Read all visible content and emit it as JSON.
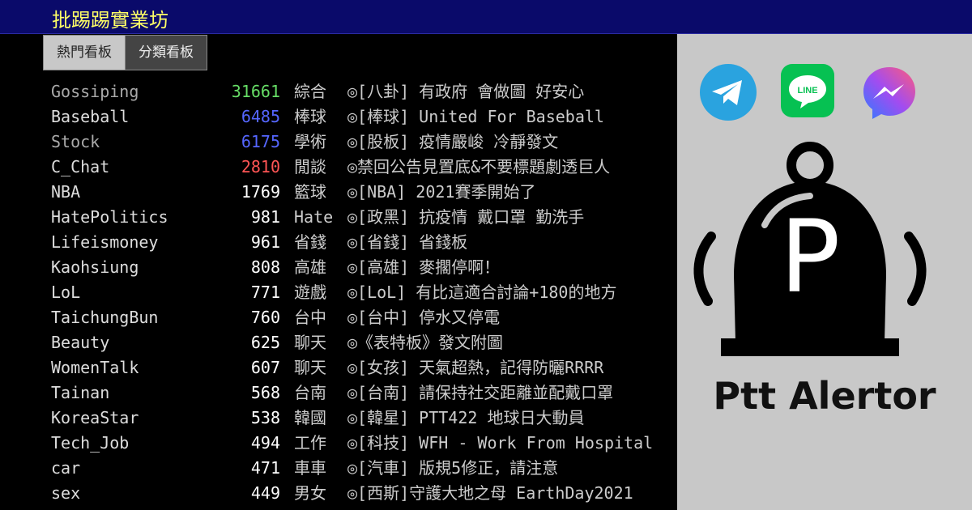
{
  "header": {
    "site_title": "批踢踢實業坊"
  },
  "tabs": [
    {
      "label": "熱門看板",
      "active": true
    },
    {
      "label": "分類看板",
      "active": false
    }
  ],
  "boards": [
    {
      "name": "Gossiping",
      "count": "31661",
      "count_color": "#66dd66",
      "category": "綜合",
      "title": "◎[八卦] 有政府 會做圖 好安心",
      "name_color": "#aaaaaa"
    },
    {
      "name": "Baseball",
      "count": "6485",
      "count_color": "#5566ff",
      "category": "棒球",
      "title": "◎[棒球] United For Baseball",
      "name_color": "#dddddd"
    },
    {
      "name": "Stock",
      "count": "6175",
      "count_color": "#5566ff",
      "category": "學術",
      "title": "◎[股板] 疫情嚴峻 冷靜發文",
      "name_color": "#aaaaaa"
    },
    {
      "name": "C_Chat",
      "count": "2810",
      "count_color": "#ff5555",
      "category": "閒談",
      "title": "◎禁回公告見置底&不要標題劇透巨人",
      "name_color": "#dddddd"
    },
    {
      "name": "NBA",
      "count": "1769",
      "count_color": "#ffffff",
      "category": "籃球",
      "title": "◎[NBA] 2021賽季開始了",
      "name_color": "#dddddd"
    },
    {
      "name": "HatePolitics",
      "count": "981",
      "count_color": "#ffffff",
      "category": "Hate",
      "title": "◎[政黑] 抗疫情 戴口罩 勤洗手",
      "name_color": "#dddddd"
    },
    {
      "name": "Lifeismoney",
      "count": "961",
      "count_color": "#ffffff",
      "category": "省錢",
      "title": "◎[省錢] 省錢板",
      "name_color": "#dddddd"
    },
    {
      "name": "Kaohsiung",
      "count": "808",
      "count_color": "#ffffff",
      "category": "高雄",
      "title": "◎[高雄] 麥擱停啊！",
      "name_color": "#dddddd"
    },
    {
      "name": "LoL",
      "count": "771",
      "count_color": "#ffffff",
      "category": "遊戲",
      "title": "◎[LoL] 有比這適合討論+180的地方",
      "name_color": "#dddddd"
    },
    {
      "name": "TaichungBun",
      "count": "760",
      "count_color": "#ffffff",
      "category": "台中",
      "title": "◎[台中] 停水又停電",
      "name_color": "#dddddd"
    },
    {
      "name": "Beauty",
      "count": "625",
      "count_color": "#ffffff",
      "category": "聊天",
      "title": "◎《表特板》發文附圖",
      "name_color": "#dddddd"
    },
    {
      "name": "WomenTalk",
      "count": "607",
      "count_color": "#ffffff",
      "category": "聊天",
      "title": "◎[女孩] 天氣超熱，記得防曬RRRR",
      "name_color": "#dddddd"
    },
    {
      "name": "Tainan",
      "count": "568",
      "count_color": "#ffffff",
      "category": "台南",
      "title": "◎[台南] 請保持社交距離並配戴口罩",
      "name_color": "#dddddd"
    },
    {
      "name": "KoreaStar",
      "count": "538",
      "count_color": "#ffffff",
      "category": "韓國",
      "title": "◎[韓星] PTT422 地球日大動員",
      "name_color": "#dddddd"
    },
    {
      "name": "Tech_Job",
      "count": "494",
      "count_color": "#ffffff",
      "category": "工作",
      "title": "◎[科技] WFH - Work From Hospital",
      "name_color": "#dddddd"
    },
    {
      "name": "car",
      "count": "471",
      "count_color": "#ffffff",
      "category": "車車",
      "title": "◎[汽車] 版規5修正，請注意",
      "name_color": "#dddddd"
    },
    {
      "name": "sex",
      "count": "449",
      "count_color": "#ffffff",
      "category": "男女",
      "title": "◎[西斯]守護大地之母 EarthDay2021",
      "name_color": "#dddddd"
    }
  ],
  "panel": {
    "bell_letter": "P",
    "brand_name": "Ptt Alertor",
    "icons": [
      {
        "name": "telegram-icon",
        "color": "#2aa3df"
      },
      {
        "name": "line-icon",
        "color": "#06c152",
        "label": "LINE"
      },
      {
        "name": "messenger-icon",
        "color": "#8a4df0"
      }
    ]
  }
}
